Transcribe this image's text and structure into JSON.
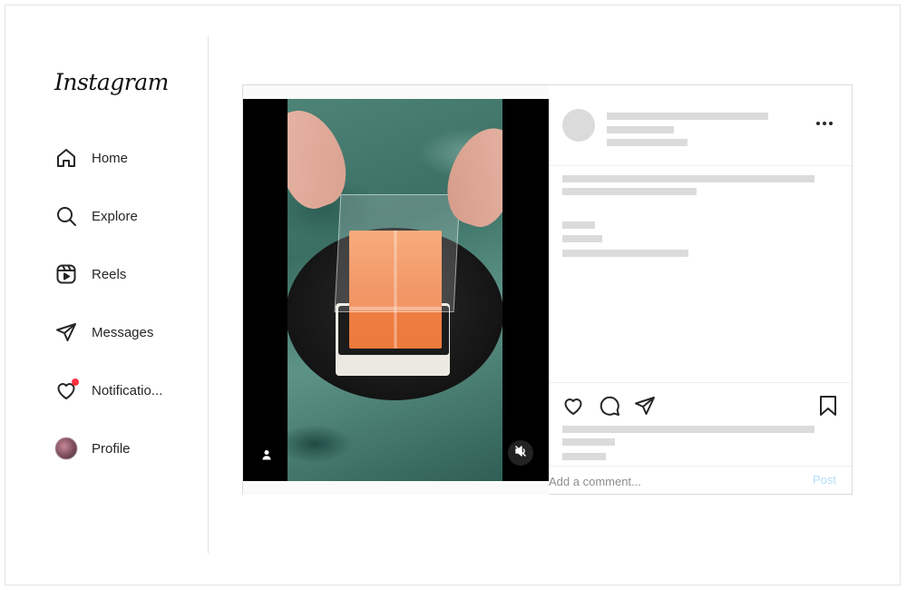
{
  "app": {
    "logo": "Instagram"
  },
  "sidebar": {
    "items": [
      {
        "label": "Home",
        "icon": "home-icon"
      },
      {
        "label": "Explore",
        "icon": "search-icon"
      },
      {
        "label": "Reels",
        "icon": "reels-icon"
      },
      {
        "label": "Messages",
        "icon": "send-icon"
      },
      {
        "label": "Notificatio...",
        "icon": "heart-icon",
        "badge": "red-dot"
      },
      {
        "label": "Profile",
        "icon": "avatar"
      }
    ]
  },
  "post": {
    "media": {
      "icons": [
        "user-tag-icon",
        "muted-speaker-icon"
      ]
    },
    "actions": {
      "icons": [
        "heart-icon",
        "comment-icon",
        "share-icon",
        "bookmark-icon"
      ]
    },
    "comment": {
      "placeholder": "Add a comment...",
      "post_label": "Post"
    }
  },
  "colors": {
    "skeleton": "#dbdbdb",
    "border": "#dbdbdb",
    "notification_dot": "#ff3040",
    "post_button_disabled": "#b2dffc"
  }
}
